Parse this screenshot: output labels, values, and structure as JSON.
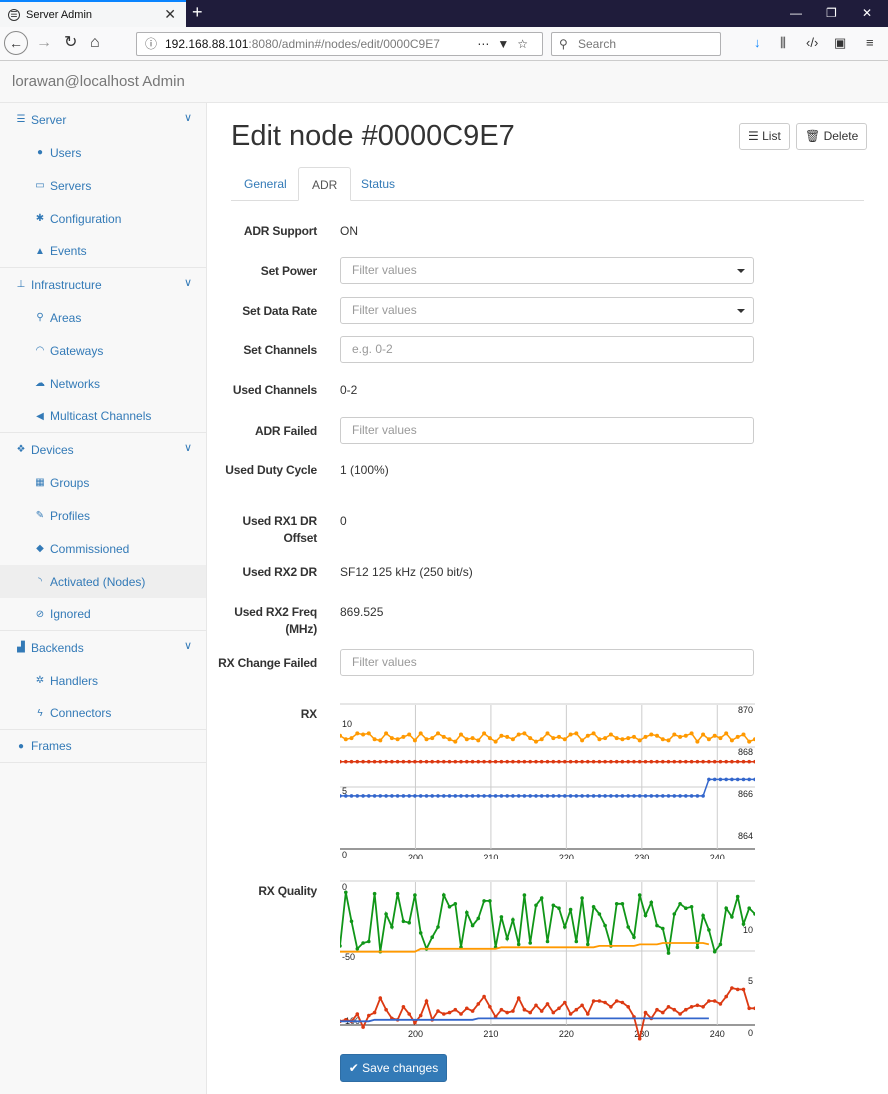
{
  "browser": {
    "tab_title": "Server Admin",
    "url_host": "192.168.88.101",
    "url_path": ":8080/admin#/nodes/edit/0000C9E7",
    "search_placeholder": "Search"
  },
  "app": {
    "brand": "lorawan@localhost Admin"
  },
  "sidebar": {
    "sections": [
      {
        "label": "Server",
        "icon": "server-icon",
        "items": [
          {
            "label": "Users",
            "icon": "user-icon"
          },
          {
            "label": "Servers",
            "icon": "monitor-icon"
          },
          {
            "label": "Configuration",
            "icon": "cog-icon"
          },
          {
            "label": "Events",
            "icon": "warning-icon"
          }
        ]
      },
      {
        "label": "Infrastructure",
        "icon": "sitemap-icon",
        "items": [
          {
            "label": "Areas",
            "icon": "pin-icon"
          },
          {
            "label": "Gateways",
            "icon": "wifi-icon"
          },
          {
            "label": "Networks",
            "icon": "cloud-icon"
          },
          {
            "label": "Multicast Channels",
            "icon": "bullhorn-icon"
          }
        ]
      },
      {
        "label": "Devices",
        "icon": "cubes-icon",
        "items": [
          {
            "label": "Groups",
            "icon": "grid-icon"
          },
          {
            "label": "Profiles",
            "icon": "edit-icon"
          },
          {
            "label": "Commissioned",
            "icon": "cube-icon"
          },
          {
            "label": "Activated (Nodes)",
            "icon": "rss-icon",
            "active": true
          },
          {
            "label": "Ignored",
            "icon": "ban-icon"
          }
        ]
      },
      {
        "label": "Backends",
        "icon": "chart-icon",
        "items": [
          {
            "label": "Handlers",
            "icon": "cogs-icon"
          },
          {
            "label": "Connectors",
            "icon": "bolt-icon"
          }
        ]
      },
      {
        "label": "Frames",
        "icon": "comments-icon",
        "items": []
      }
    ]
  },
  "page": {
    "title": "Edit node #0000C9E7",
    "list_button": "List",
    "delete_button": "Delete",
    "tabs": [
      {
        "label": "General"
      },
      {
        "label": "ADR"
      },
      {
        "label": "Status"
      }
    ],
    "fields": {
      "adr_support": {
        "label": "ADR Support",
        "value": "ON"
      },
      "set_power": {
        "label": "Set Power",
        "placeholder": "Filter values"
      },
      "set_data_rate": {
        "label": "Set Data Rate",
        "placeholder": "Filter values"
      },
      "set_channels": {
        "label": "Set Channels",
        "placeholder": "e.g. 0-2"
      },
      "used_channels": {
        "label": "Used Channels",
        "value": "0-2"
      },
      "adr_failed": {
        "label": "ADR Failed",
        "placeholder": "Filter values"
      },
      "used_duty_cycle": {
        "label": "Used Duty Cycle",
        "value": "1 (100%)"
      },
      "used_rx1_dr_offset": {
        "label": "Used RX1 DR Offset",
        "value": "0"
      },
      "used_rx2_dr": {
        "label": "Used RX2 DR",
        "value": "SF12 125 kHz (250 bit/s)"
      },
      "used_rx2_freq": {
        "label": "Used RX2 Freq (MHz)",
        "value": "869.525"
      },
      "rx_change_failed": {
        "label": "RX Change Failed",
        "placeholder": "Filter values"
      }
    },
    "rx_label": "RX",
    "rx_quality_label": "RX Quality",
    "save_button": "Save changes"
  },
  "chart_data": [
    {
      "type": "line",
      "xlim": [
        190,
        245
      ],
      "x_ticks": [
        "200",
        "210",
        "220",
        "230",
        "240"
      ],
      "y_left_ticks": [
        "10",
        "5",
        "0"
      ],
      "y_right_ticks": [
        "870",
        "868",
        "866",
        "864"
      ],
      "grid": true,
      "series": [
        {
          "color": "#ff9900",
          "values": [
            9.6,
            9.3,
            9.4,
            9.8,
            9.7,
            9.8,
            9.3,
            9.2,
            9.8,
            9.4,
            9.3,
            9.5,
            9.7,
            9.2,
            9.8,
            9.3,
            9.4,
            9.8,
            9.5,
            9.3,
            9.1,
            9.7,
            9.3,
            9.4,
            9.2,
            9.8,
            9.4,
            9.1,
            9.6,
            9.5,
            9.3,
            9.7,
            9.8,
            9.4,
            9.1,
            9.3,
            9.8,
            9.4,
            9.5,
            9.3,
            9.7,
            9.8,
            9.2,
            9.6,
            9.8,
            9.3,
            9.4,
            9.7,
            9.4,
            9.3,
            9.4,
            9.5,
            9.2,
            9.5,
            9.7,
            9.6,
            9.3,
            9.2,
            9.7,
            9.5,
            9.6,
            9.8,
            9.1,
            9.7,
            9.3,
            9.6,
            9.4,
            9.8,
            9.2,
            9.5,
            9.7,
            9.1,
            9.3
          ]
        },
        {
          "color": "#dc3912",
          "values": [
            7.4,
            7.4,
            7.4,
            7.4,
            7.4,
            7.4,
            7.4,
            7.4,
            7.4,
            7.4,
            7.4,
            7.4,
            7.4,
            7.4,
            7.4,
            7.4,
            7.4,
            7.4,
            7.4,
            7.4,
            7.4,
            7.4,
            7.4,
            7.4,
            7.4,
            7.4,
            7.4,
            7.4,
            7.4,
            7.4,
            7.4,
            7.4,
            7.4,
            7.4,
            7.4,
            7.4,
            7.4,
            7.4,
            7.4,
            7.4,
            7.4,
            7.4,
            7.4,
            7.4,
            7.4,
            7.4,
            7.4,
            7.4,
            7.4,
            7.4,
            7.4,
            7.4,
            7.4,
            7.4,
            7.4,
            7.4,
            7.4,
            7.4,
            7.4,
            7.4,
            7.4,
            7.4,
            7.4,
            7.4,
            7.4,
            7.4,
            7.4,
            7.4,
            7.4,
            7.4,
            7.4,
            7.4,
            7.4
          ]
        },
        {
          "color": "#3366cc",
          "values": [
            4.5,
            4.5,
            4.5,
            4.5,
            4.5,
            4.5,
            4.5,
            4.5,
            4.5,
            4.5,
            4.5,
            4.5,
            4.5,
            4.5,
            4.5,
            4.5,
            4.5,
            4.5,
            4.5,
            4.5,
            4.5,
            4.5,
            4.5,
            4.5,
            4.5,
            4.5,
            4.5,
            4.5,
            4.5,
            4.5,
            4.5,
            4.5,
            4.5,
            4.5,
            4.5,
            4.5,
            4.5,
            4.5,
            4.5,
            4.5,
            4.5,
            4.5,
            4.5,
            4.5,
            4.5,
            4.5,
            4.5,
            4.5,
            4.5,
            4.5,
            4.5,
            4.5,
            4.5,
            4.5,
            4.5,
            4.5,
            4.5,
            4.5,
            4.5,
            4.5,
            4.5,
            4.5,
            4.5,
            4.5,
            5.9,
            5.9,
            5.9,
            5.9,
            5.9,
            5.9,
            5.9,
            5.9,
            5.9
          ]
        }
      ]
    },
    {
      "type": "line",
      "xlim": [
        190,
        245
      ],
      "x_ticks": [
        "200",
        "210",
        "220",
        "230",
        "240"
      ],
      "y_left_ticks": [
        "0",
        "-50",
        "-100"
      ],
      "y_right_ticks": [
        "10",
        "5",
        "0"
      ],
      "grid": true,
      "series": [
        {
          "color": "#109618",
          "values": [
            -42,
            -5,
            -25,
            -44,
            -40,
            -39,
            -6,
            -46,
            -20,
            -29,
            -6,
            -25,
            -26,
            -7,
            -33,
            -44,
            -36,
            -29,
            -7,
            -15,
            -13,
            -43,
            -19,
            -28,
            -23,
            -11,
            -11,
            -43,
            -22,
            -37,
            -24,
            -41,
            -7,
            -40,
            -14,
            -9,
            -39,
            -14,
            -16,
            -29,
            -17,
            -39,
            -9,
            -41,
            -15,
            -20,
            -28,
            -42,
            -13,
            -13,
            -29,
            -36,
            -7,
            -21,
            -12,
            -28,
            -30,
            -47,
            -20,
            -13,
            -16,
            -15,
            -43,
            -21,
            -31,
            -46,
            -41,
            -16,
            -22,
            -8,
            -27,
            -16,
            -20
          ]
        },
        {
          "color": "#ff9900",
          "values": [
            -46,
            -46,
            -46,
            -46,
            -46,
            -46,
            -46,
            -46,
            -46,
            -46,
            -46,
            -46,
            -46,
            -46,
            -44,
            -44,
            -44,
            -44,
            -44,
            -44,
            -44,
            -44,
            -44,
            -44,
            -44,
            -44,
            -44,
            -44,
            -43,
            -43,
            -43,
            -43,
            -43,
            -43,
            -43,
            -43,
            -43,
            -43,
            -43,
            -43,
            -43,
            -43,
            -43,
            -43,
            -43,
            -42,
            -42,
            -42,
            -42,
            -42,
            -42,
            -42,
            -41,
            -41,
            -41,
            -41,
            -40,
            -40,
            -40,
            -40,
            -40,
            -40,
            -40,
            -40,
            -41
          ]
        },
        {
          "color": "#dc3912",
          "values": [
            -94,
            -93,
            -94,
            -89,
            -98,
            -90,
            -88,
            -78,
            -86,
            -92,
            -93,
            -84,
            -89,
            -95,
            -90,
            -80,
            -93,
            -87,
            -89,
            -88,
            -86,
            -89,
            -85,
            -87,
            -82,
            -77,
            -84,
            -91,
            -86,
            -88,
            -87,
            -78,
            -86,
            -88,
            -83,
            -87,
            -82,
            -88,
            -85,
            -81,
            -89,
            -86,
            -83,
            -89,
            -80,
            -80,
            -81,
            -84,
            -80,
            -81,
            -84,
            -91,
            -106,
            -88,
            -92,
            -86,
            -88,
            -84,
            -86,
            -89,
            -86,
            -84,
            -83,
            -84,
            -80,
            -80,
            -82,
            -77,
            -71,
            -72,
            -72,
            -85,
            -85
          ]
        },
        {
          "color": "#3366cc",
          "values": [
            -94,
            -94,
            -94,
            -94,
            -94,
            -94,
            -93,
            -93,
            -93,
            -93,
            -93,
            -93,
            -93,
            -93,
            -93,
            -93,
            -93,
            -93,
            -93,
            -93,
            -93,
            -93,
            -93,
            -93,
            -92,
            -92,
            -92,
            -92,
            -92,
            -92,
            -92,
            -92,
            -92,
            -92,
            -92,
            -92,
            -92,
            -92,
            -92,
            -92,
            -92,
            -92,
            -92,
            -92,
            -92,
            -92,
            -92,
            -92,
            -92,
            -92,
            -92,
            -92,
            -92,
            -92,
            -92,
            -92,
            -92,
            -92,
            -92,
            -92,
            -92,
            -92,
            -92,
            -92,
            -92
          ]
        }
      ]
    }
  ]
}
